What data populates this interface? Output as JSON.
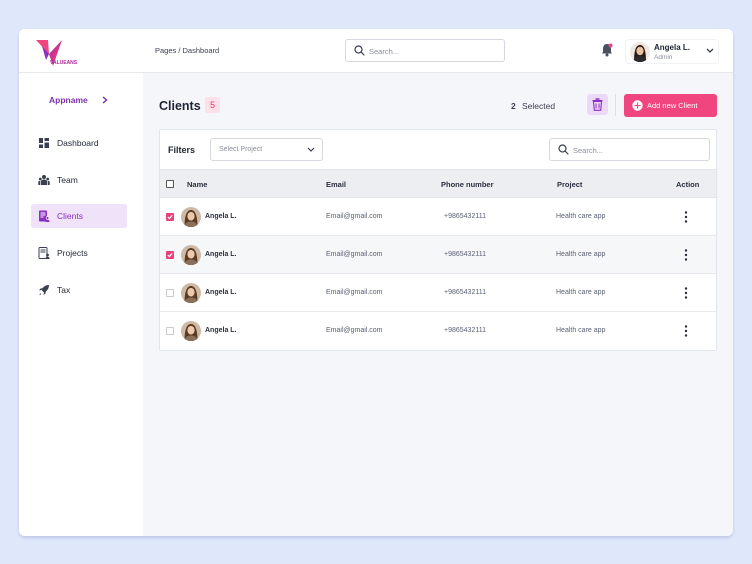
{
  "brand": {
    "logo_text": "VALUEANS",
    "accent": "#f0457e",
    "purple": "#8a2fc2"
  },
  "header": {
    "breadcrumb": "Pages / Dashboard",
    "search_placeholder": "Search...",
    "user_name": "Angela L.",
    "user_role": "Admin"
  },
  "sidebar": {
    "appname": "Appname",
    "items": [
      {
        "label": "Dashboard",
        "icon": "dashboard-icon",
        "active": false
      },
      {
        "label": "Team",
        "icon": "team-icon",
        "active": false
      },
      {
        "label": "Clients",
        "icon": "clients-icon",
        "active": true
      },
      {
        "label": "Projects",
        "icon": "projects-icon",
        "active": false
      },
      {
        "label": "Tax",
        "icon": "rocket-icon",
        "active": false
      }
    ]
  },
  "main": {
    "title": "Clients",
    "count": "5",
    "selected_count": "2",
    "selected_label": "Selected",
    "add_button": "Add new Client",
    "filters_label": "Filters",
    "project_select_placeholder": "Select Project",
    "search_placeholder": "Search..."
  },
  "table": {
    "columns": [
      "Name",
      "Email",
      "Phone number",
      "Project",
      "Action"
    ],
    "rows": [
      {
        "name": "Angela L.",
        "email": "Email@gmail.com",
        "phone": "+9865432111",
        "project": "Health care app",
        "checked": true
      },
      {
        "name": "Angela L.",
        "email": "Email@gmail.com",
        "phone": "+9865432111",
        "project": "Health care app",
        "checked": true
      },
      {
        "name": "Angela L.",
        "email": "Email@gmail.com",
        "phone": "+9865432111",
        "project": "Health care app",
        "checked": false
      },
      {
        "name": "Angela L.",
        "email": "Email@gmail.com",
        "phone": "+9865432111",
        "project": "Health care app",
        "checked": false
      }
    ]
  }
}
